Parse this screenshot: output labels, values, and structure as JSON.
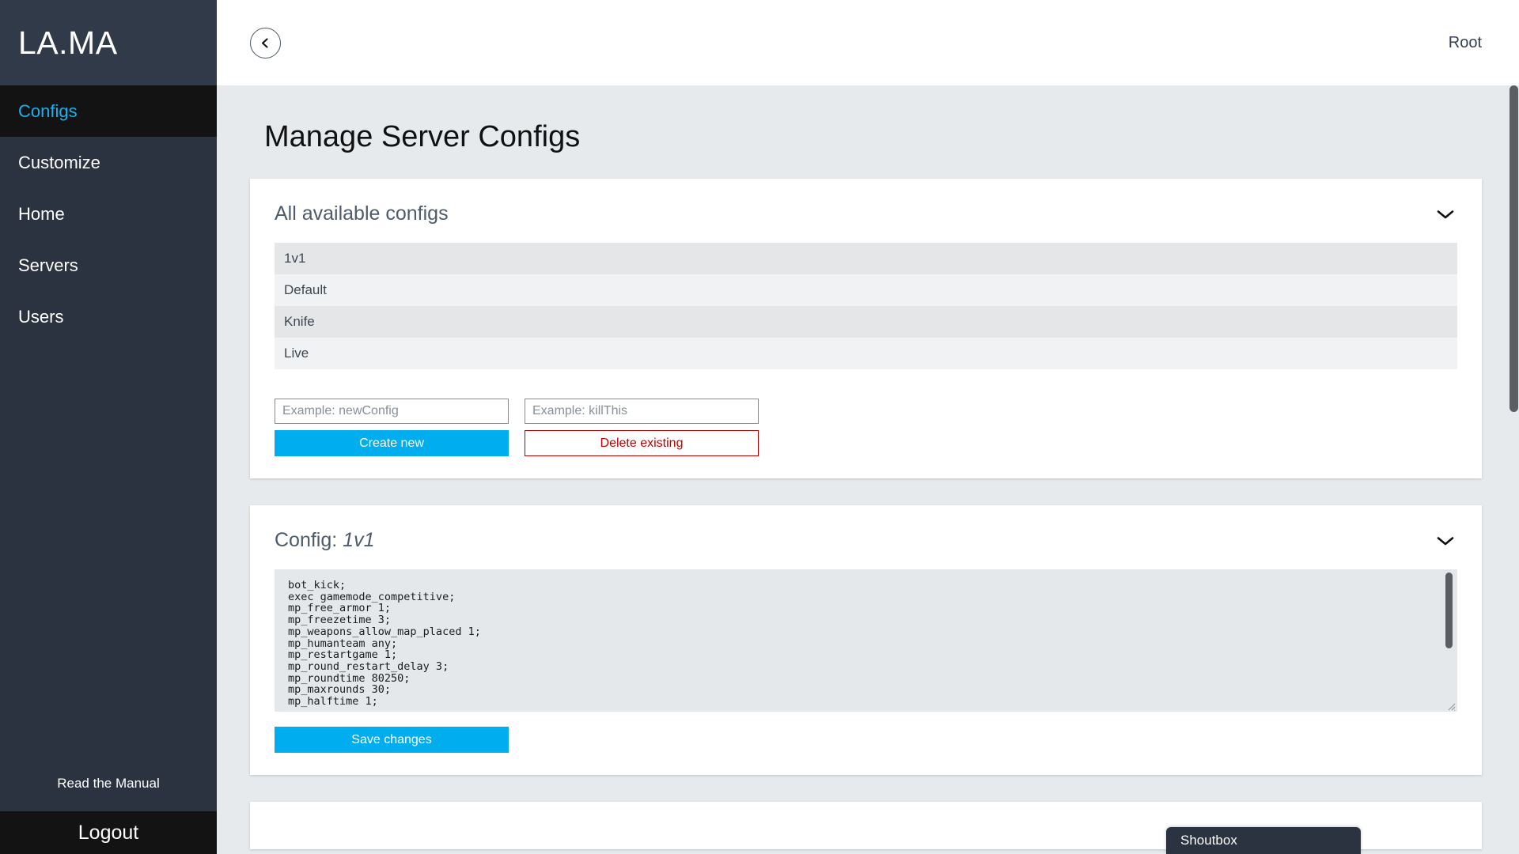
{
  "sidebar": {
    "brand": "LA.MA",
    "items": [
      {
        "label": "Configs",
        "active": true
      },
      {
        "label": "Customize",
        "active": false
      },
      {
        "label": "Home",
        "active": false
      },
      {
        "label": "Servers",
        "active": false
      },
      {
        "label": "Users",
        "active": false
      }
    ],
    "read_manual": "Read the Manual",
    "logout": "Logout"
  },
  "topbar": {
    "back_icon": "chevron-left-icon",
    "user": "Root"
  },
  "page": {
    "title": "Manage Server Configs"
  },
  "cards": {
    "available": {
      "title": "All available configs",
      "collapse_icon": "chevron-down-icon",
      "configs": [
        "1v1",
        "Default",
        "Knife",
        "Live"
      ],
      "create_placeholder": "Example: newConfig",
      "create_value": "",
      "create_label": "Create new",
      "delete_placeholder": "Example: killThis",
      "delete_value": "",
      "delete_label": "Delete existing"
    },
    "config_editor": {
      "title_prefix": "Config:",
      "title_name": "1v1",
      "collapse_icon": "chevron-down-icon",
      "content": "bot_kick;\nexec gamemode_competitive;\nmp_free_armor 1;\nmp_freezetime 3;\nmp_weapons_allow_map_placed 1;\nmp_humanteam any;\nmp_restartgame 1;\nmp_round_restart_delay 3;\nmp_roundtime 80250;\nmp_maxrounds 30;\nmp_halftime 1;",
      "save_label": "Save changes"
    }
  },
  "shoutbox": {
    "title": "Shoutbox"
  },
  "colors": {
    "accent": "#00aeef",
    "sidebar_bg": "#2b3340",
    "sidebar_active_bg": "#131313",
    "sidebar_active_text": "#19b0f1",
    "page_bg": "#e6eaed",
    "danger": "#c00000",
    "card_bg": "#ffffff",
    "row_odd": "#e4e6e8",
    "row_even": "#f1f2f3",
    "editor_bg": "#e4e8eb"
  }
}
